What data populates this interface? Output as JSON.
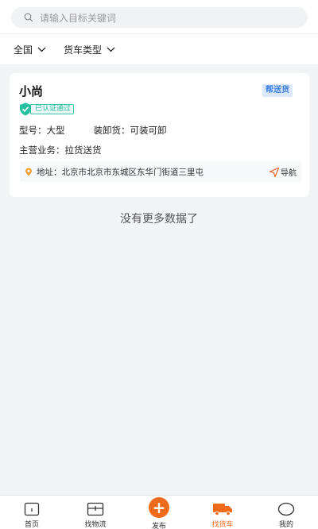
{
  "search": {
    "placeholder": "请输入目标关键词"
  },
  "filters": [
    {
      "label": "全国"
    },
    {
      "label": "货车类型"
    }
  ],
  "card": {
    "name": "小尚",
    "badge": "帮送货",
    "verified": "已认证通过",
    "model_label": "型号：",
    "model_value": "大型",
    "loading_label": "装卸货：",
    "loading_value": "可装可卸",
    "business_label": "主营业务：",
    "business_value": "拉货送货",
    "address_label": "地址：",
    "address_value": "北京市北京市东城区东华门街道三里屯",
    "nav_label": "导航"
  },
  "no_more": "没有更多数据了",
  "tabbar": {
    "home": "首页",
    "logistics": "找物流",
    "publish": "发布",
    "truck": "找货车",
    "mine": "我的"
  },
  "colors": {
    "accent": "#f06a1c",
    "verified": "#1db69b",
    "badge": "#3d7fe0"
  }
}
